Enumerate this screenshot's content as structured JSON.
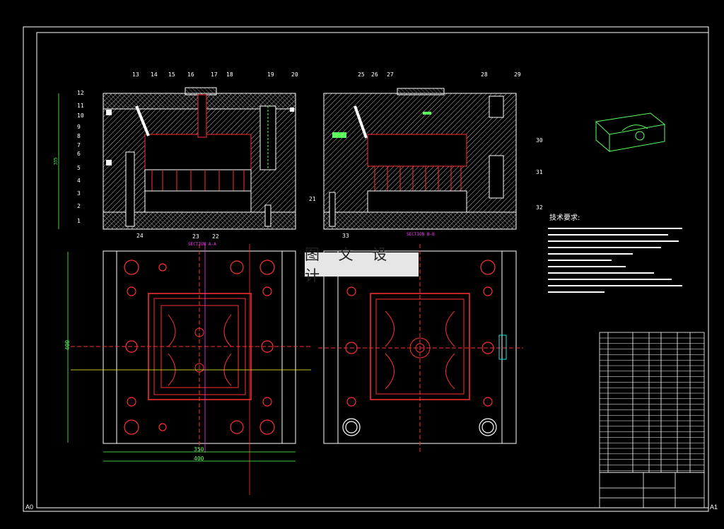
{
  "drawing": {
    "sheet_left_label": "A0",
    "sheet_right_label": "A1",
    "watermark": "图 文 设 计",
    "section_aa": "SECTION A-A",
    "section_bb": "SECTION B-B",
    "tech_req_title": "技术要求:",
    "dimensions": {
      "height_left": "400",
      "width_inner": "350",
      "width_outer": "400",
      "side_height": "335"
    },
    "left_view_part_numbers": [
      "13",
      "14",
      "15",
      "16",
      "17",
      "18",
      "19",
      "20"
    ],
    "left_callouts": [
      "12",
      "11",
      "10",
      "9",
      "8",
      "7",
      "6",
      "5",
      "4",
      "3",
      "2",
      "1"
    ],
    "bottom_left_callouts": [
      "24",
      "23",
      "22"
    ],
    "right_view_part_numbers": [
      "25",
      "26",
      "27",
      "28",
      "29"
    ],
    "right_side_callouts": [
      "30",
      "31",
      "32"
    ],
    "bottom_right_callouts": [
      "21",
      "33"
    ],
    "colors": {
      "background": "#000000",
      "frame": "#ffffff",
      "hatch": "#c8c8c8",
      "mold_red": "#ff2a2a",
      "dimension_green": "#5cff5c",
      "magenta": "#ff33ff",
      "yellow": "#ffff33",
      "cyan": "#22e0e0"
    }
  }
}
